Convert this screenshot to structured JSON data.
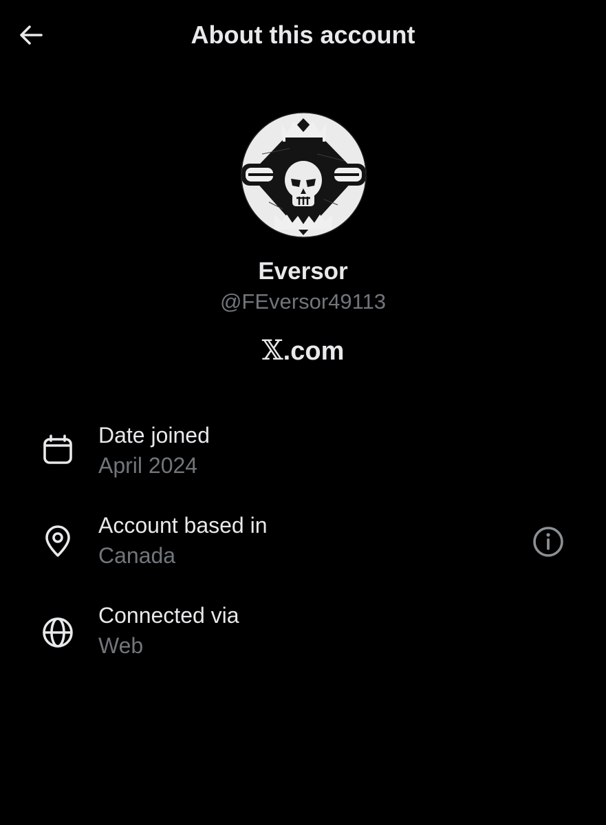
{
  "header": {
    "title": "About this account",
    "back_icon": "arrow-left-icon"
  },
  "profile": {
    "avatar": "skull-logo-avatar",
    "display_name": "Eversor",
    "handle": "@FEversor49113",
    "platform_mark": "𝕏",
    "platform_suffix": ".com"
  },
  "details": [
    {
      "icon": "calendar-icon",
      "label": "Date joined",
      "value": "April 2024"
    },
    {
      "icon": "location-pin-icon",
      "label": "Account based in",
      "value": "Canada",
      "action_icon": "info-icon"
    },
    {
      "icon": "globe-icon",
      "label": "Connected via",
      "value": "Web"
    }
  ],
  "colors": {
    "background": "#000000",
    "primary_text": "#e7e9ea",
    "secondary_text": "#71767b"
  }
}
